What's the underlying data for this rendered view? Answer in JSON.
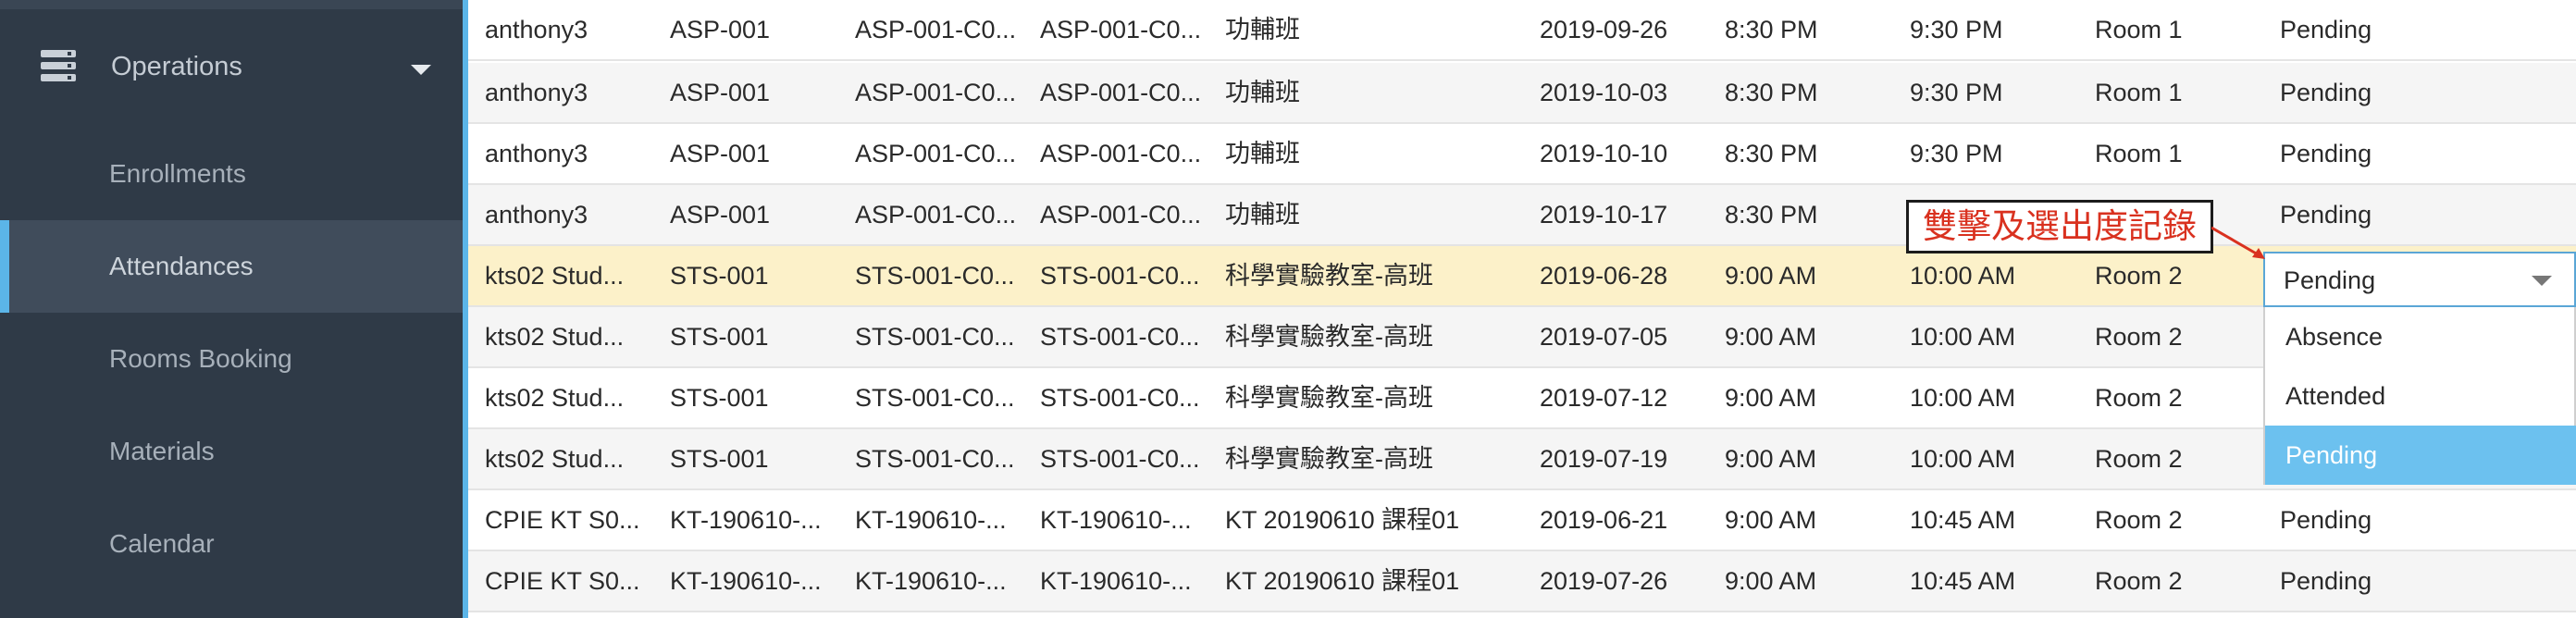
{
  "sidebar": {
    "section_label": "Operations",
    "items": [
      {
        "label": "Enrollments"
      },
      {
        "label": "Attendances"
      },
      {
        "label": "Rooms Booking"
      },
      {
        "label": "Materials"
      },
      {
        "label": "Calendar"
      }
    ],
    "active_item": "Attendances"
  },
  "table": {
    "rows": [
      [
        "anthony3",
        "ASP-001",
        "ASP-001-C0...",
        "ASP-001-C0...",
        "功輔班",
        "2019-09-26",
        "8:30 PM",
        "9:30 PM",
        "Room 1",
        "Pending"
      ],
      [
        "anthony3",
        "ASP-001",
        "ASP-001-C0...",
        "ASP-001-C0...",
        "功輔班",
        "2019-10-03",
        "8:30 PM",
        "9:30 PM",
        "Room 1",
        "Pending"
      ],
      [
        "anthony3",
        "ASP-001",
        "ASP-001-C0...",
        "ASP-001-C0...",
        "功輔班",
        "2019-10-10",
        "8:30 PM",
        "9:30 PM",
        "Room 1",
        "Pending"
      ],
      [
        "anthony3",
        "ASP-001",
        "ASP-001-C0...",
        "ASP-001-C0...",
        "功輔班",
        "2019-10-17",
        "8:30 PM",
        "9:30 PM",
        "Room 1",
        "Pending"
      ],
      [
        "kts02 Stud...",
        "STS-001",
        "STS-001-C0...",
        "STS-001-C0...",
        "科學實驗教室-高班",
        "2019-06-28",
        "9:00 AM",
        "10:00 AM",
        "Room 2",
        ""
      ],
      [
        "kts02 Stud...",
        "STS-001",
        "STS-001-C0...",
        "STS-001-C0...",
        "科學實驗教室-高班",
        "2019-07-05",
        "9:00 AM",
        "10:00 AM",
        "Room 2",
        ""
      ],
      [
        "kts02 Stud...",
        "STS-001",
        "STS-001-C0...",
        "STS-001-C0...",
        "科學實驗教室-高班",
        "2019-07-12",
        "9:00 AM",
        "10:00 AM",
        "Room 2",
        ""
      ],
      [
        "kts02 Stud...",
        "STS-001",
        "STS-001-C0...",
        "STS-001-C0...",
        "科學實驗教室-高班",
        "2019-07-19",
        "9:00 AM",
        "10:00 AM",
        "Room 2",
        ""
      ],
      [
        "CPIE KT S0...",
        "KT-190610-...",
        "KT-190610-...",
        "KT-190610-...",
        "KT 20190610 課程01",
        "2019-06-21",
        "9:00 AM",
        "10:45 AM",
        "Room 2",
        "Pending"
      ],
      [
        "CPIE KT S0...",
        "KT-190610-...",
        "KT-190610-...",
        "KT-190610-...",
        "KT 20190610 課程01",
        "2019-07-26",
        "9:00 AM",
        "10:45 AM",
        "Room 2",
        "Pending"
      ]
    ],
    "selected_row": 4
  },
  "status_dropdown": {
    "value": "Pending",
    "options": [
      "Absence",
      "Attended",
      "Pending"
    ],
    "highlighted": "Pending"
  },
  "annotation": {
    "text": "雙擊及選出度記錄",
    "color": "#d9311f"
  },
  "colors": {
    "sidebar_bg": "#2f3a47",
    "sidebar_active_bg": "#404c5b",
    "accent": "#5bb5e8",
    "selected_row_bg": "#fcf1c9",
    "dropdown_highlight": "#6cc1ef"
  }
}
